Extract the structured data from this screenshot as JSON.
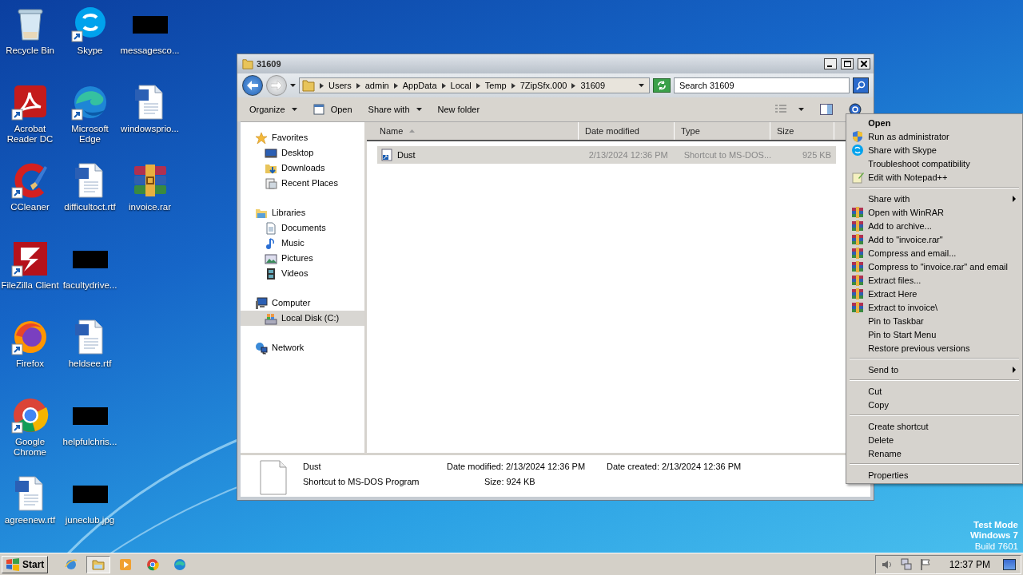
{
  "desktop_icons": [
    {
      "label": "Recycle Bin",
      "kind": "recycle",
      "shortcut": false
    },
    {
      "label": "Acrobat Reader DC",
      "kind": "acrobat",
      "shortcut": true
    },
    {
      "label": "CCleaner",
      "kind": "ccleaner",
      "shortcut": true
    },
    {
      "label": "FileZilla Client",
      "kind": "filezilla",
      "shortcut": true
    },
    {
      "label": "Firefox",
      "kind": "firefox",
      "shortcut": true
    },
    {
      "label": "Google Chrome",
      "kind": "chrome",
      "shortcut": true
    },
    {
      "label": "agreenew.rtf",
      "kind": "word",
      "shortcut": false
    },
    {
      "label": "Skype",
      "kind": "skype",
      "shortcut": true
    },
    {
      "label": "Microsoft Edge",
      "kind": "edge",
      "shortcut": true
    },
    {
      "label": "difficultoct.rtf",
      "kind": "word",
      "shortcut": false
    },
    {
      "label": "facultydrive...",
      "kind": "thumbnail",
      "shortcut": false
    },
    {
      "label": "heldsee.rtf",
      "kind": "word",
      "shortcut": false
    },
    {
      "label": "helpfulchris...",
      "kind": "thumbnail",
      "shortcut": false
    },
    {
      "label": "juneclub.jpg",
      "kind": "thumbnail",
      "shortcut": false
    },
    {
      "label": "messagesco...",
      "kind": "thumbnail",
      "shortcut": false
    },
    {
      "label": "windowsprio...",
      "kind": "word",
      "shortcut": false
    },
    {
      "label": "invoice.rar",
      "kind": "rar",
      "shortcut": false
    }
  ],
  "window": {
    "title": "31609",
    "breadcrumb": [
      "Users",
      "admin",
      "AppData",
      "Local",
      "Temp",
      "7ZipSfx.000",
      "31609"
    ],
    "search": {
      "placeholder": "Search 31609"
    },
    "toolbar": [
      {
        "label": "Organize",
        "kind": "menu"
      },
      {
        "label": "Open",
        "kind": "icon"
      },
      {
        "label": "Share with",
        "kind": "menu"
      },
      {
        "label": "New folder",
        "kind": "plain"
      }
    ],
    "nav": [
      {
        "label": "Favorites",
        "kind": "star",
        "selected": false,
        "children": [
          {
            "label": "Desktop",
            "kind": "desktop",
            "selected": false
          },
          {
            "label": "Downloads",
            "kind": "downloads",
            "selected": false
          },
          {
            "label": "Recent Places",
            "kind": "recent",
            "selected": false
          }
        ]
      },
      {
        "label": "Libraries",
        "kind": "library",
        "selected": false,
        "children": [
          {
            "label": "Documents",
            "kind": "documents",
            "selected": false
          },
          {
            "label": "Music",
            "kind": "music",
            "selected": false
          },
          {
            "label": "Pictures",
            "kind": "pictures",
            "selected": false
          },
          {
            "label": "Videos",
            "kind": "videos",
            "selected": false
          }
        ]
      },
      {
        "label": "Computer",
        "kind": "computer",
        "selected": false,
        "children": [
          {
            "label": "Local Disk (C:)",
            "kind": "disk",
            "selected": true
          }
        ]
      },
      {
        "label": "Network",
        "kind": "network",
        "selected": false
      }
    ],
    "columns": [
      {
        "label": "Name",
        "sorted": true
      },
      {
        "label": "Date modified",
        "sorted": false
      },
      {
        "label": "Type",
        "sorted": false
      },
      {
        "label": "Size",
        "sorted": false
      }
    ],
    "files": [
      {
        "name": "Dust",
        "date": "2/13/2024 12:36 PM",
        "type": "Shortcut to MS-DOS...",
        "size": "925 KB",
        "selected": true
      }
    ],
    "details": {
      "name": "Dust",
      "type": "Shortcut to MS-DOS Program",
      "fields": [
        {
          "label": "Date modified:",
          "value": "2/13/2024 12:36 PM"
        },
        {
          "label": "Date created:",
          "value": "2/13/2024 12:36 PM"
        },
        {
          "label": "Size:",
          "value": "924 KB"
        }
      ]
    }
  },
  "context_menu": {
    "sections": [
      [
        {
          "label": "Open",
          "kind": "plain",
          "default": true,
          "submenu": false
        },
        {
          "label": "Run as administrator",
          "kind": "shield",
          "default": false,
          "submenu": false
        },
        {
          "label": "Share with Skype",
          "kind": "skype",
          "default": false,
          "submenu": false
        },
        {
          "label": "Troubleshoot compatibility",
          "kind": "plain",
          "default": false,
          "submenu": false
        },
        {
          "label": "Edit with Notepad++",
          "kind": "notepad",
          "default": false,
          "submenu": false
        }
      ],
      [
        {
          "label": "Share with",
          "kind": "plain",
          "default": false,
          "submenu": true
        },
        {
          "label": "Open with WinRAR",
          "kind": "winrar",
          "default": false,
          "submenu": false
        },
        {
          "label": "Add to archive...",
          "kind": "winrar",
          "default": false,
          "submenu": false
        },
        {
          "label": "Add to \"invoice.rar\"",
          "kind": "winrar",
          "default": false,
          "submenu": false
        },
        {
          "label": "Compress and email...",
          "kind": "winrar",
          "default": false,
          "submenu": false
        },
        {
          "label": "Compress to \"invoice.rar\" and email",
          "kind": "winrar",
          "default": false,
          "submenu": false
        },
        {
          "label": "Extract files...",
          "kind": "winrar",
          "default": false,
          "submenu": false
        },
        {
          "label": "Extract Here",
          "kind": "winrar",
          "default": false,
          "submenu": false
        },
        {
          "label": "Extract to invoice\\",
          "kind": "winrar",
          "default": false,
          "submenu": false
        },
        {
          "label": "Pin to Taskbar",
          "kind": "plain",
          "default": false,
          "submenu": false
        },
        {
          "label": "Pin to Start Menu",
          "kind": "plain",
          "default": false,
          "submenu": false
        },
        {
          "label": "Restore previous versions",
          "kind": "plain",
          "default": false,
          "submenu": false
        }
      ],
      [
        {
          "label": "Send to",
          "kind": "plain",
          "default": false,
          "submenu": true
        }
      ],
      [
        {
          "label": "Cut",
          "kind": "plain",
          "default": false,
          "submenu": false
        },
        {
          "label": "Copy",
          "kind": "plain",
          "default": false,
          "submenu": false
        }
      ],
      [
        {
          "label": "Create shortcut",
          "kind": "plain",
          "default": false,
          "submenu": false
        },
        {
          "label": "Delete",
          "kind": "plain",
          "default": false,
          "submenu": false
        },
        {
          "label": "Rename",
          "kind": "plain",
          "default": false,
          "submenu": false
        }
      ],
      [
        {
          "label": "Properties",
          "kind": "plain",
          "default": false,
          "submenu": false
        }
      ]
    ]
  },
  "test_mode": [
    "Test Mode",
    "Windows 7",
    "Build 7601"
  ],
  "taskbar": {
    "start": "Start",
    "apps": [
      {
        "kind": "ie",
        "active": false
      },
      {
        "kind": "explorer",
        "active": true
      },
      {
        "kind": "media",
        "active": false
      },
      {
        "kind": "chrome",
        "active": false
      },
      {
        "kind": "edge",
        "active": false
      }
    ],
    "clock": "12:37 PM"
  }
}
